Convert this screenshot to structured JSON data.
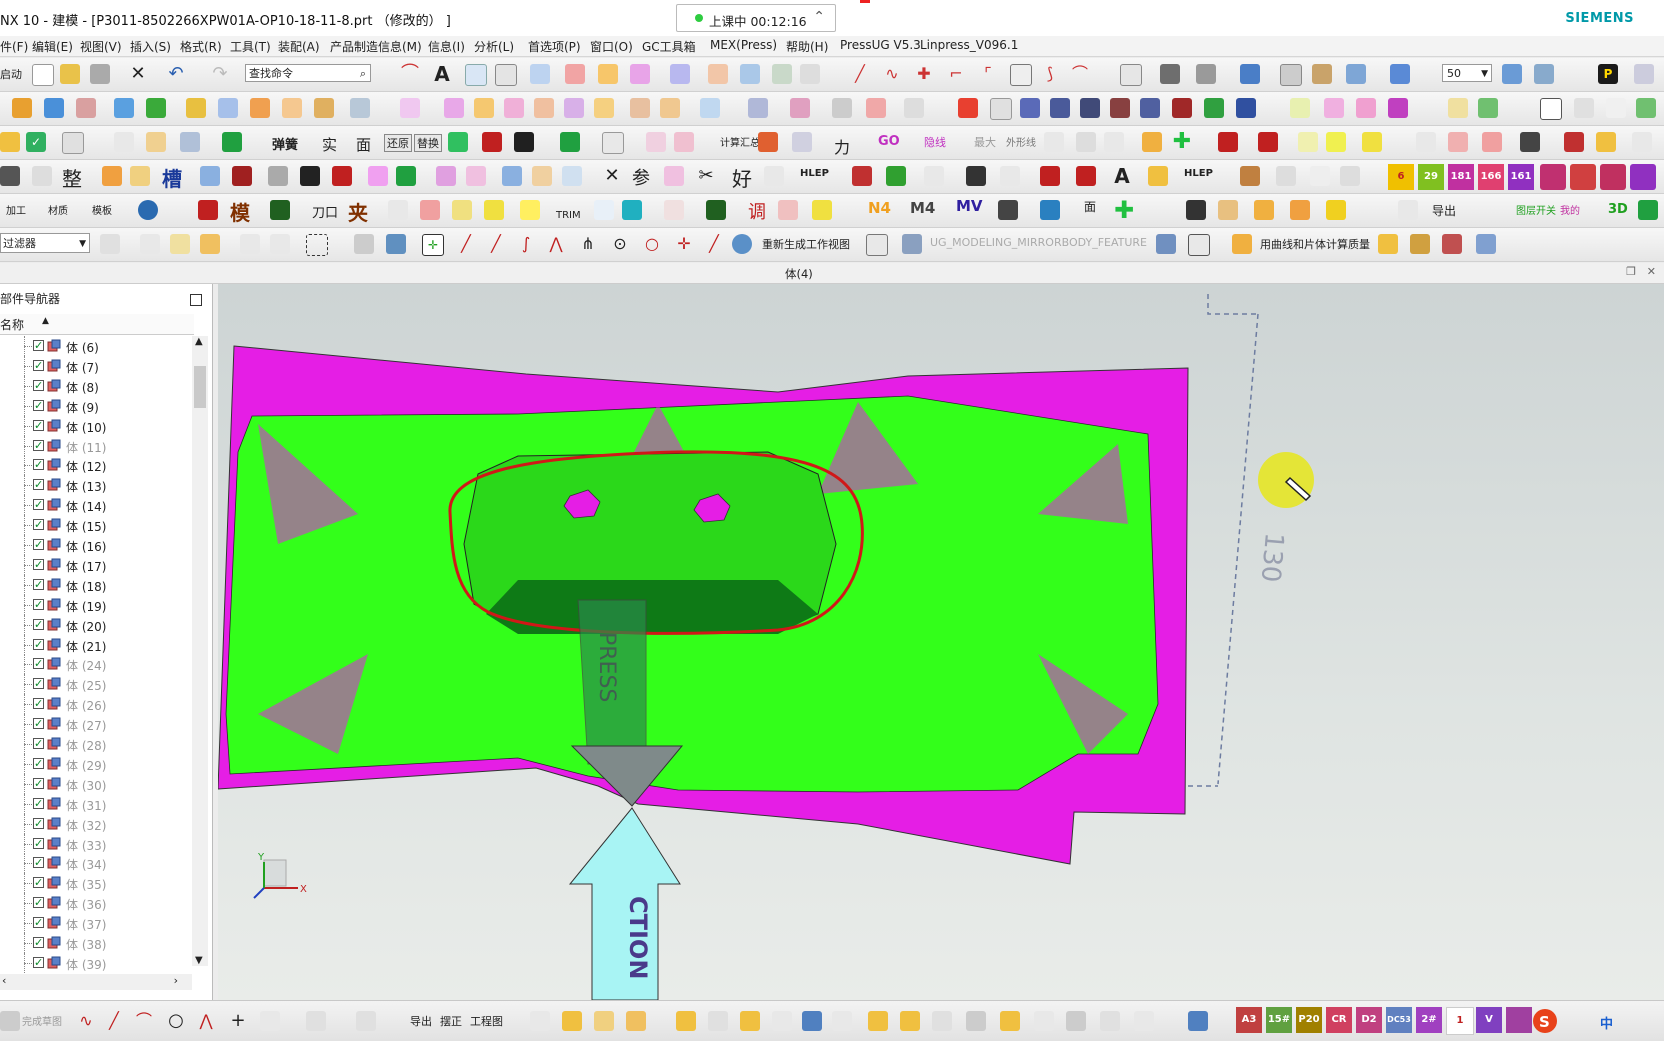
{
  "titlebar": {
    "title": "NX 10 - 建模 - [P3011-8502266XPW01A-OP10-18-11-8.prt （修改的） ]",
    "timer": "上课中 00:12:16",
    "brand": "SIEMENS"
  },
  "menu": [
    "件(F)",
    "编辑(E)",
    "视图(V)",
    "插入(S)",
    "格式(R)",
    "工具(T)",
    "装配(A)",
    "产品制造信息(M)",
    "信息(I)",
    "分析(L)",
    "首选项(P)",
    "窗口(O)",
    "GC工具箱",
    "MEX(Press)",
    "帮助(H)",
    "PressUG V5.3",
    "Linpress_V096.1"
  ],
  "toolbar": {
    "start_label": "启动",
    "search_placeholder": "查找命令",
    "zoom_value": "50",
    "row3_labels": [
      "弹簧",
      "实",
      "面",
      "还原",
      "替换",
      "计算汇总",
      "力",
      "GO",
      "隐线",
      "最大",
      "外形线"
    ],
    "row4_labels": [
      "整",
      "槽",
      "HLEP",
      "HLEP",
      "好",
      "参"
    ],
    "row4_numbers": [
      "6",
      "29",
      "181",
      "166",
      "161"
    ],
    "row5_labels": [
      "加工",
      "材质",
      "模板",
      "模",
      "刀口",
      "夹",
      "TRIM",
      "调",
      "N4",
      "M4",
      "MV",
      "面",
      "导出",
      "图层开关",
      "我的",
      "3D"
    ],
    "filter_label": "过滤器",
    "regen_label": "重新生成工作视图",
    "feature_label": "UG_MODELING_MIRRORBODY_FEATURE",
    "mass_label": "用曲线和片体计算质量"
  },
  "doc": {
    "title": "体(4)"
  },
  "navigator": {
    "title": "部件导航器",
    "column": "名称",
    "items": [
      {
        "label": "体 (6)",
        "dim": false
      },
      {
        "label": "体 (7)",
        "dim": false
      },
      {
        "label": "体 (8)",
        "dim": false
      },
      {
        "label": "体 (9)",
        "dim": false
      },
      {
        "label": "体 (10)",
        "dim": false
      },
      {
        "label": "体 (11)",
        "dim": true
      },
      {
        "label": "体 (12)",
        "dim": false
      },
      {
        "label": "体 (13)",
        "dim": false
      },
      {
        "label": "体 (14)",
        "dim": false
      },
      {
        "label": "体 (15)",
        "dim": false
      },
      {
        "label": "体 (16)",
        "dim": false
      },
      {
        "label": "体 (17)",
        "dim": false
      },
      {
        "label": "体 (18)",
        "dim": false
      },
      {
        "label": "体 (19)",
        "dim": false
      },
      {
        "label": "体 (20)",
        "dim": false
      },
      {
        "label": "体 (21)",
        "dim": false
      },
      {
        "label": "体 (24)",
        "dim": true
      },
      {
        "label": "体 (25)",
        "dim": true
      },
      {
        "label": "体 (26)",
        "dim": true
      },
      {
        "label": "体 (27)",
        "dim": true
      },
      {
        "label": "体 (28)",
        "dim": true
      },
      {
        "label": "体 (29)",
        "dim": true
      },
      {
        "label": "体 (30)",
        "dim": true
      },
      {
        "label": "体 (31)",
        "dim": true
      },
      {
        "label": "体 (32)",
        "dim": true
      },
      {
        "label": "体 (33)",
        "dim": true
      },
      {
        "label": "体 (34)",
        "dim": true
      },
      {
        "label": "体 (35)",
        "dim": true
      },
      {
        "label": "体 (36)",
        "dim": true
      },
      {
        "label": "体 (37)",
        "dim": true
      },
      {
        "label": "体 (38)",
        "dim": true
      },
      {
        "label": "体 (39)",
        "dim": true
      }
    ]
  },
  "viewport": {
    "press_label": "PRESS",
    "direction_label": "CTION",
    "dimension_label": "130",
    "axis_x": "X",
    "axis_y": "Y",
    "colors": {
      "face_green": "#33ff1a",
      "face_magenta": "#e51ee5",
      "markup_red": "#d01818",
      "arrow_cyan": "#a8f4f4",
      "cursor_yellow": "#e6e61a"
    }
  },
  "bottombar": {
    "labels": [
      "完成草图",
      "导出",
      "摆正",
      "工程图"
    ],
    "tiles": [
      "A3",
      "15#",
      "P20",
      "CR",
      "D2",
      "DC53",
      "2#",
      "1",
      "V"
    ],
    "ime": "中"
  }
}
